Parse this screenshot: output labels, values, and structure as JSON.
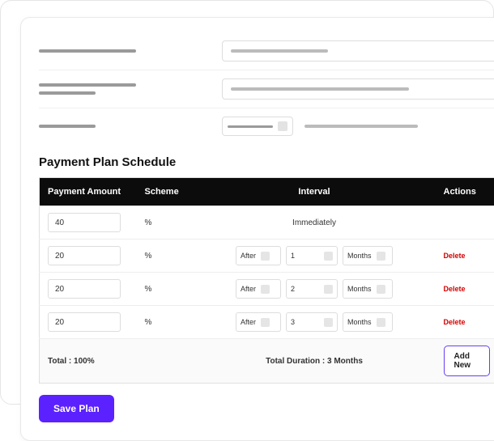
{
  "section_title": "Payment Plan Schedule",
  "table": {
    "headers": {
      "amount": "Payment Amount",
      "scheme": "Scheme",
      "interval": "Interval",
      "actions": "Actions"
    },
    "rows": [
      {
        "amount": "40",
        "scheme": "%",
        "immediate": true,
        "immediate_label": "Immediately"
      },
      {
        "amount": "20",
        "scheme": "%",
        "timing": "After",
        "value": "1",
        "unit": "Months",
        "delete_label": "Delete"
      },
      {
        "amount": "20",
        "scheme": "%",
        "timing": "After",
        "value": "2",
        "unit": "Months",
        "delete_label": "Delete"
      },
      {
        "amount": "20",
        "scheme": "%",
        "timing": "After",
        "value": "3",
        "unit": "Months",
        "delete_label": "Delete"
      }
    ],
    "footer": {
      "total_label": "Total : 100%",
      "duration_label": "Total Duration : 3 Months",
      "add_new_label": "Add New"
    }
  },
  "save_label": "Save Plan"
}
